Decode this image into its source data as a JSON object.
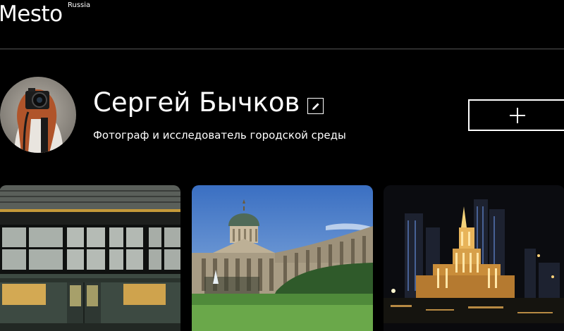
{
  "header": {
    "logo": "Mesto",
    "logo_sup": "Russia"
  },
  "profile": {
    "name": "Сергей Бычков",
    "about": "Фотограф и исследователь городской среды",
    "avatar_icon": "photographer-avatar",
    "edit_icon": "pencil-icon",
    "add_icon": "plus-icon"
  },
  "cards": [
    {
      "subject": "metro-train"
    },
    {
      "subject": "kazan-cathedral"
    },
    {
      "subject": "moscow-night-skyline"
    }
  ],
  "colors": {
    "background": "#000000",
    "text": "#ffffff",
    "divider": "#545454"
  }
}
